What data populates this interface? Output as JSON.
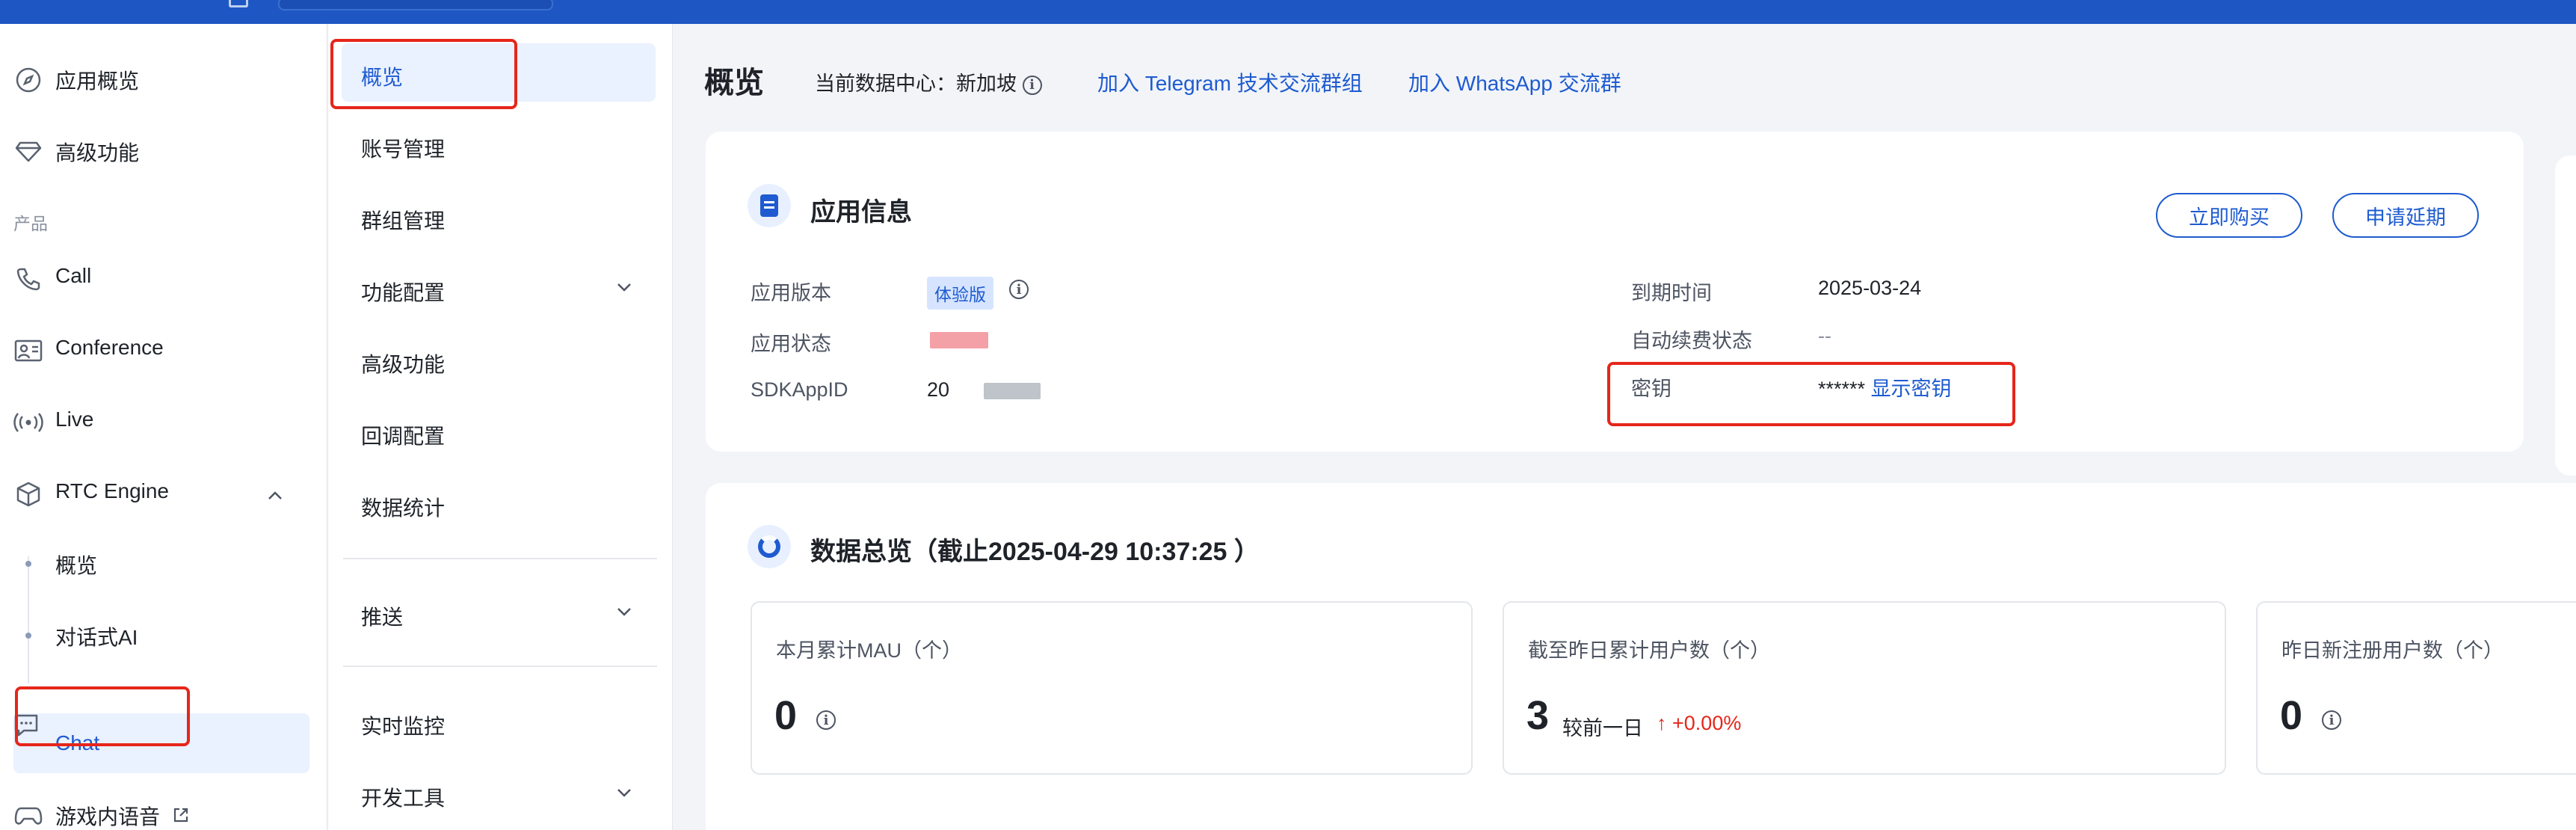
{
  "sidebar_primary": {
    "items": [
      {
        "label": "应用概览",
        "icon": "compass-icon"
      },
      {
        "label": "高级功能",
        "icon": "diamond-icon"
      }
    ],
    "section_label": "产品",
    "products": [
      {
        "label": "Call",
        "icon": "phone-icon"
      },
      {
        "label": "Conference",
        "icon": "conference-icon"
      },
      {
        "label": "Live",
        "icon": "broadcast-icon"
      },
      {
        "label": "RTC Engine",
        "icon": "cube-icon"
      }
    ],
    "rtc_sub": [
      {
        "label": "概览"
      },
      {
        "label": "对话式AI"
      }
    ],
    "chat": {
      "label": "Chat",
      "icon": "chat-icon"
    },
    "game_voice": {
      "label": "游戏内语音",
      "icon": "gamepad-icon"
    }
  },
  "sidebar_secondary": {
    "items": [
      {
        "label": "概览",
        "active": true
      },
      {
        "label": "账号管理"
      },
      {
        "label": "群组管理"
      },
      {
        "label": "功能配置",
        "expandable": true
      },
      {
        "label": "高级功能"
      },
      {
        "label": "回调配置"
      },
      {
        "label": "数据统计"
      },
      {
        "label": "推送",
        "expandable": true
      },
      {
        "label": "实时监控"
      },
      {
        "label": "开发工具",
        "expandable": true
      }
    ]
  },
  "header": {
    "title": "概览",
    "data_center_label": "当前数据中心：新加坡",
    "link_telegram": "加入 Telegram 技术交流群组",
    "link_whatsapp": "加入 WhatsApp 交流群"
  },
  "app_info": {
    "title": "应用信息",
    "buy_button": "立即购买",
    "extend_button": "申请延期",
    "version_label": "应用版本",
    "version_tag": "体验版",
    "status_label": "应用状态",
    "sdkappid_label": "SDKAppID",
    "sdkappid_prefix": "20",
    "expire_label": "到期时间",
    "expire_value": "2025-03-24",
    "renew_label": "自动续费状态",
    "renew_value": "--",
    "secret_label": "密钥",
    "secret_value": "******",
    "secret_link": "显示密钥"
  },
  "data_overview": {
    "title": "数据总览（截止2025-04-29 10:37:25 ）",
    "metrics": [
      {
        "label": "本月累计MAU（个）",
        "value": "0"
      },
      {
        "label": "截至昨日累计用户数（个）",
        "value": "3",
        "compare": "较前一日",
        "change": "+0.00%"
      },
      {
        "label": "昨日新注册用户数（个）",
        "value": "0"
      }
    ]
  },
  "colors": {
    "accent": "#1e5bd0",
    "topbar": "#1e57c3",
    "highlight": "#e5261a",
    "active_bg": "#eaf1ff"
  }
}
